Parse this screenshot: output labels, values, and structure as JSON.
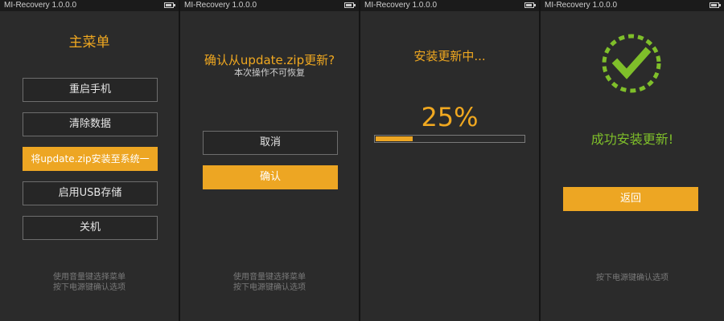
{
  "screens": [
    {
      "status_title": "MI-Recovery 1.0.0.0",
      "title": "主菜单",
      "menu": [
        "重启手机",
        "清除数据",
        "将update.zip安装至系统一",
        "启用USB存储",
        "关机"
      ],
      "hint": [
        "使用音量键选择菜单",
        "按下电源键确认选项"
      ]
    },
    {
      "status_title": "MI-Recovery 1.0.0.0",
      "title": "确认从update.zip更新?",
      "subtitle": "本次操作不可恢复",
      "cancel_label": "取消",
      "confirm_label": "确认",
      "hint": [
        "使用音量键选择菜单",
        "按下电源键确认选项"
      ]
    },
    {
      "status_title": "MI-Recovery 1.0.0.0",
      "title": "安装更新中...",
      "progress_text": "25%",
      "progress": 0.25
    },
    {
      "status_title": "MI-Recovery 1.0.0.0",
      "success_text": "成功安装更新!",
      "back_label": "返回",
      "hint": "按下电源键确认选项"
    }
  ],
  "colors": {
    "accent": "#eda623",
    "success": "#7fbf2a",
    "background": "#2b2b2b"
  },
  "icons": {
    "status": "battery-icon",
    "success": "check-circle-icon"
  }
}
